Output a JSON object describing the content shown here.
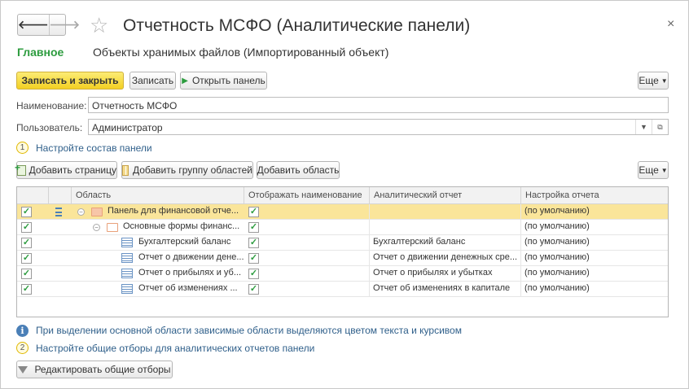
{
  "window": {
    "title": "Отчетность МСФО (Аналитические панели)",
    "close_glyph": "×"
  },
  "nav": {
    "back_glyph": "🡐",
    "forward_glyph": "🡒",
    "star_glyph": "☆"
  },
  "tabs": {
    "main": "Главное",
    "files": "Объекты хранимых файлов (Импортированный объект)"
  },
  "toolbar": {
    "save_close": "Записать и закрыть",
    "save": "Записать",
    "open_panel": "Открыть панель",
    "more": "Еще"
  },
  "form": {
    "name_label": "Наименование:",
    "name_value": "Отчетность МСФО",
    "user_label": "Пользователь:",
    "user_value": "Администратор"
  },
  "step1": {
    "num": "1",
    "link": "Настройте состав панели"
  },
  "grid_toolbar": {
    "add_page": "Добавить страницу",
    "add_group": "Добавить группу областей",
    "add_area": "Добавить область",
    "more": "Еще"
  },
  "grid": {
    "columns": [
      "Область",
      "Отображать наименование",
      "Аналитический отчет",
      "Настройка отчета"
    ],
    "check_glyph": "✓",
    "rows": [
      {
        "area": "Панель для финансовой отче...",
        "report": "",
        "setting": "(по умолчанию)"
      },
      {
        "area": "Основные формы финанс...",
        "report": "",
        "setting": "(по умолчанию)"
      },
      {
        "area": "Бухгалтерский баланс",
        "report": "Бухгалтерский баланс",
        "setting": "(по умолчанию)"
      },
      {
        "area": "Отчет о движении дене...",
        "report": "Отчет о движении денежных сре...",
        "setting": "(по умолчанию)"
      },
      {
        "area": "Отчет о прибылях и уб...",
        "report": "Отчет о прибылях и убытках",
        "setting": "(по умолчанию)"
      },
      {
        "area": "Отчет об изменениях ...",
        "report": "Отчет об изменениях в капитале",
        "setting": "(по умолчанию)"
      }
    ]
  },
  "info": {
    "icon": "i",
    "text": "При выделении основной области зависимые области выделяются цветом текста и курсивом"
  },
  "step2": {
    "num": "2",
    "link": "Настройте общие отборы для аналитических отчетов панели"
  },
  "edit_filters": "Редактировать общие отборы",
  "colors": {
    "accent_green": "#2d9c3f",
    "primary_yellow": "#f3d023",
    "selected_row": "#fae59a",
    "link": "#2f5f8a"
  }
}
